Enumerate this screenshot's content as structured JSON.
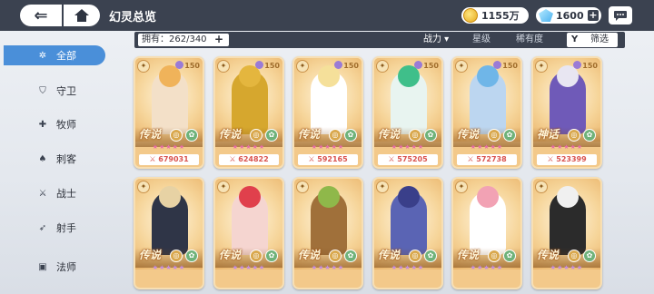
{
  "header": {
    "title": "幻灵总览",
    "gold": "1155万",
    "gems": "1600"
  },
  "filter": {
    "owned_label": "拥有：262/340",
    "sort_power": "战力 ▾",
    "sort_star": "星级",
    "sort_rarity": "稀有度",
    "filter_label": "筛选"
  },
  "sidebar": {
    "items": [
      {
        "label": "全部",
        "icon": "star-icon"
      },
      {
        "label": "守卫",
        "icon": "shield-icon"
      },
      {
        "label": "牧师",
        "icon": "healer-icon"
      },
      {
        "label": "刺客",
        "icon": "assassin-icon"
      },
      {
        "label": "战士",
        "icon": "sword-icon"
      },
      {
        "label": "射手",
        "icon": "bow-icon"
      },
      {
        "label": "法师",
        "icon": "book-icon"
      }
    ]
  },
  "cards_row1": [
    {
      "level": "150",
      "rarity": "传说",
      "power": "679031",
      "hair": "#f0b35a",
      "outfit": "#f3e0c8"
    },
    {
      "level": "150",
      "rarity": "传说",
      "power": "624822",
      "hair": "#e4b63e",
      "outfit": "#d6a72e"
    },
    {
      "level": "150",
      "rarity": "传说",
      "power": "592165",
      "hair": "#f5e09a",
      "outfit": "#ffffff"
    },
    {
      "level": "150",
      "rarity": "传说",
      "power": "575205",
      "hair": "#3fbf8a",
      "outfit": "#e8f4f0"
    },
    {
      "level": "150",
      "rarity": "传说",
      "power": "572738",
      "hair": "#6fb6e8",
      "outfit": "#bcd6f0"
    },
    {
      "level": "150",
      "rarity": "神话",
      "power": "523399",
      "hair": "#e8e6f2",
      "outfit": "#6f5ab8"
    }
  ],
  "cards_row2": [
    {
      "rarity": "传说",
      "hair": "#e7d2a4",
      "outfit": "#2f3547"
    },
    {
      "rarity": "传说",
      "hair": "#e0404c",
      "outfit": "#f5d5d0"
    },
    {
      "rarity": "传说",
      "hair": "#8fb84a",
      "outfit": "#a0703a"
    },
    {
      "rarity": "传说",
      "hair": "#3a3f8a",
      "outfit": "#5a64b4"
    },
    {
      "rarity": "传说",
      "hair": "#f2a2b4",
      "outfit": "#ffffff"
    },
    {
      "rarity": "传说",
      "hair": "#f0f0f0",
      "outfit": "#2b2b2b"
    }
  ]
}
